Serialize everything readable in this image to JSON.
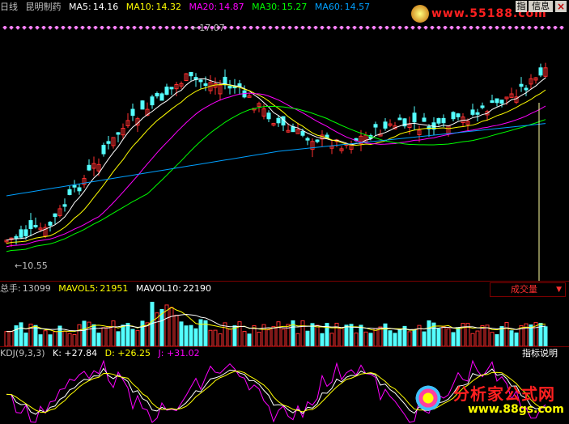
{
  "header": {
    "mode": "日线",
    "stock_name": "昆明制药",
    "ma": [
      {
        "label": "MA5:",
        "value": "14.16",
        "color": "#ffffff"
      },
      {
        "label": "MA10:",
        "value": "14.32",
        "color": "#ffff00"
      },
      {
        "label": "MA20:",
        "value": "14.87",
        "color": "#ff00ff"
      },
      {
        "label": "MA30:",
        "value": "15.27",
        "color": "#00ff00"
      },
      {
        "label": "MA60:",
        "value": "14.57",
        "color": "#00a0ff"
      }
    ],
    "logo_text": "www.55188.com",
    "btn_pointer": "指",
    "btn_info": "信息",
    "btn_close": "×"
  },
  "price_chart": {
    "high_label": "17.07",
    "low_label": "10.55",
    "high_marker": "←",
    "low_marker": "←"
  },
  "volume_header": {
    "total_label": "总手:",
    "total_value": "13099",
    "mavol5_label": "MAVOL5:",
    "mavol5_value": "21951",
    "mavol10_label": "MAVOL10:",
    "mavol10_value": "22190",
    "indicator": "成交量",
    "indicator_arrow": "▼"
  },
  "kdj_header": {
    "name": "KDJ(9,3,3)",
    "k": "K: +27.84",
    "d": "D: +26.25",
    "j": "J: +31.02",
    "help": "指标说明"
  },
  "watermark": {
    "title": "分析家公式网",
    "url": "www.88gs.com"
  },
  "colors": {
    "up": "#ff3030",
    "down": "#54ffff",
    "separator": "#7a0000"
  }
}
